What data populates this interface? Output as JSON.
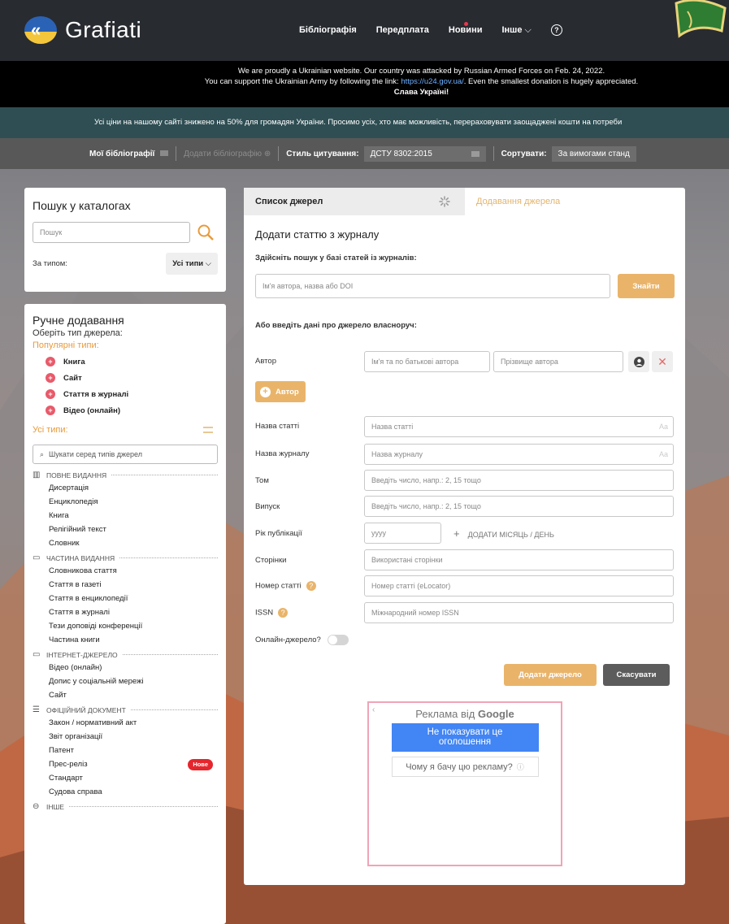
{
  "header": {
    "logo_text": "Grafiati",
    "nav": [
      "Бібліографія",
      "Передплата",
      "Новини",
      "Інше"
    ]
  },
  "ua_banner": {
    "line1": "We are proudly a Ukrainian website. Our country was attacked by Russian Armed Forces on Feb. 24, 2022.",
    "line2_pre": "You can support the Ukrainian Army by following the link: ",
    "line2_link": "https://u24.gov.ua/",
    "line2_post": ". Even the smallest donation is hugely appreciated.",
    "line3": "Слава Україні!"
  },
  "notice": "Усі ціни на нашому сайті знижено на 50% для громадян України. Просимо усіх, хто має можливість, перераховувати заощаджені кошти на потреби",
  "toolbar": {
    "my_bibs": "Мої бібліографії",
    "add_bib": "Додати бібліографію",
    "citation_style_label": "Стиль цитування:",
    "citation_style_value": "ДСТУ 8302:2015",
    "sort_label": "Сортувати:",
    "sort_value": "За вимогами станд"
  },
  "catalog_search": {
    "title": "Пошук у каталогах",
    "placeholder": "Пошук",
    "type_label": "За типом:",
    "type_value": "Усі типи"
  },
  "manual": {
    "title": "Ручне додавання",
    "subtitle": "Оберіть тип джерела:",
    "popular_label": "Популярні типи:",
    "popular": [
      "Книга",
      "Сайт",
      "Стаття в журналі",
      "Відео (онлайн)"
    ],
    "all_label": "Усі типи:",
    "search_placeholder": "Шукати серед типів джерел",
    "new_badge": "Нове",
    "categories": [
      {
        "name": "Повне видання",
        "items": [
          "Дисертація",
          "Енциклопедія",
          "Книга",
          "Релігійний текст",
          "Словник"
        ]
      },
      {
        "name": "Частина видання",
        "items": [
          "Словникова стаття",
          "Стаття в газеті",
          "Стаття в енциклопедії",
          "Стаття в журналі",
          "Тези доповіді конференції",
          "Частина книги"
        ]
      },
      {
        "name": "Інтернет-джерело",
        "items": [
          "Відео (онлайн)",
          "Допис у соціальній мережі",
          "Сайт"
        ]
      },
      {
        "name": "Офіційний документ",
        "items": [
          "Закон / нормативний акт",
          "Звіт організації",
          "Патент",
          "Прес-реліз",
          "Стандарт",
          "Судова справа"
        ]
      },
      {
        "name": "Інше",
        "items": []
      }
    ]
  },
  "main": {
    "tab_list": "Список джерел",
    "tab_add": "Додавання джерела",
    "heading": "Додати статтю з журналу",
    "search_label": "Здійсніть пошук у базі статей із журналів:",
    "search_placeholder": "Ім'я автора, назва або DOI",
    "search_button": "Знайти",
    "manual_label": "Або введіть дані про джерело власноруч:",
    "author_label": "Автор",
    "author_first_placeholder": "Ім'я та по батькові автора",
    "author_last_placeholder": "Прізвище автора",
    "add_author": "Автор",
    "fields": {
      "article_title_label": "Назва статті",
      "article_title_ph": "Назва статті",
      "journal_label": "Назва журналу",
      "journal_ph": "Назва журналу",
      "volume_label": "Том",
      "volume_ph": "Введіть число, напр.: 2, 15 тощо",
      "issue_label": "Випуск",
      "issue_ph": "Введіть число, напр.: 2, 15 тощо",
      "year_label": "Рік публікації",
      "year_ph": "уууу",
      "add_date": "ДОДАТИ МІСЯЦЬ / ДЕНЬ",
      "pages_label": "Сторінки",
      "pages_ph": "Використані сторінки",
      "article_no_label": "Номер статті",
      "article_no_ph": "Номер статті (eLocator)",
      "issn_label": "ISSN",
      "issn_ph": "Міжнародний номер ISSN",
      "online_label": "Онлайн-джерело?",
      "case_aa": "Aa"
    },
    "submit": "Додати джерело",
    "cancel": "Скасувати"
  },
  "ad": {
    "title_pre": "Реклама від ",
    "title_brand": "Google",
    "hide_button": "Не показувати це оголошення",
    "why": "Чому я бачу цю рекламу?"
  }
}
